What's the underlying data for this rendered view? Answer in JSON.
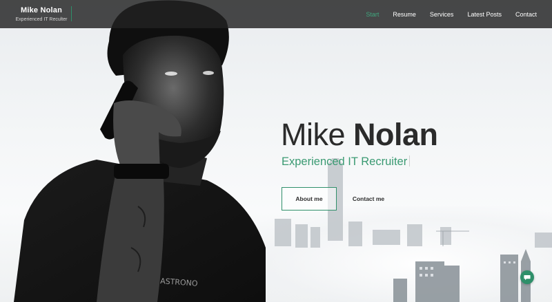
{
  "brand": {
    "name": "Mike Nolan",
    "subtitle": "Experienced IT Reculter"
  },
  "nav": {
    "items": [
      {
        "label": "Start",
        "active": true
      },
      {
        "label": "Resume",
        "active": false
      },
      {
        "label": "Services",
        "active": false
      },
      {
        "label": "Latest Posts",
        "active": false
      },
      {
        "label": "Contact",
        "active": false
      }
    ]
  },
  "hero": {
    "first_name": "Mike",
    "last_name": "Nolan",
    "tagline": "Experienced IT Recruiter",
    "primary_button": "About me",
    "secondary_button": "Contact me"
  },
  "chat": {
    "icon": "chat-bubble-icon"
  },
  "colors": {
    "accent": "#3fa77e",
    "accent_dark": "#2f8f6a",
    "header_bg": "#222222",
    "text_dark": "#2b2b2b"
  }
}
